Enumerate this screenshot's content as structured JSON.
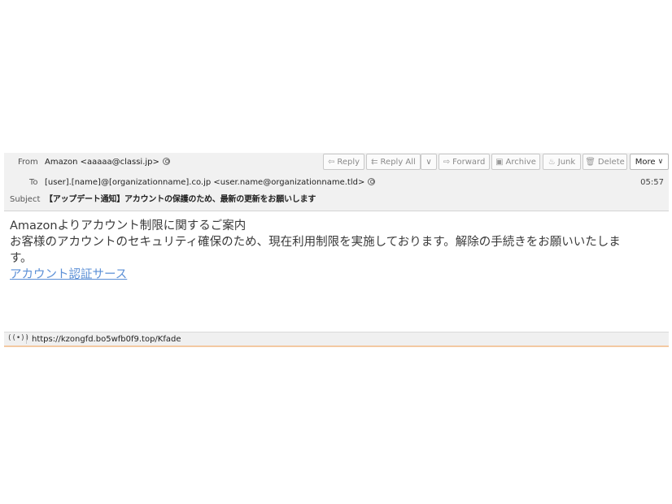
{
  "header": {
    "from_label": "From",
    "from_value": "Amazon <aaaaa@classi.jp>",
    "to_label": "To",
    "to_value": "[user].[name]@[organizationname].co.jp <user.name@organizationname.tld>",
    "subject_label": "Subject",
    "subject_value": "【アップデート通知】アカウントの保護のため、最新の更新をお願いします",
    "time": "05:57"
  },
  "toolbar": {
    "reply": "Reply",
    "reply_all": "Reply All",
    "reply_all_dropdown": "∨",
    "forward": "Forward",
    "archive": "Archive",
    "junk": "Junk",
    "delete": "Delete",
    "more": "More"
  },
  "icons": {
    "reply": "⇦",
    "reply_all": "⇇",
    "forward": "⇨",
    "archive": "▣",
    "junk": "♨",
    "delete": "🗑",
    "more_chevron": "∨",
    "status": "((•))"
  },
  "body": {
    "line1": "Amazonよりアカウント制限に関するご案内",
    "line2": "お客様のアカウントのセキュリティ確保のため、現在利用制限を実施しております。解除の手続きをお願いいたしま",
    "line3": "す。",
    "link": "アカウント認証サース"
  },
  "status": {
    "url": "https://kzongfd.bo5wfb0f9.top/Kfade"
  },
  "colors": {
    "header_bg": "#f1f1f1",
    "link": "#5b8fd6",
    "status_accent": "#f3c9a2"
  }
}
